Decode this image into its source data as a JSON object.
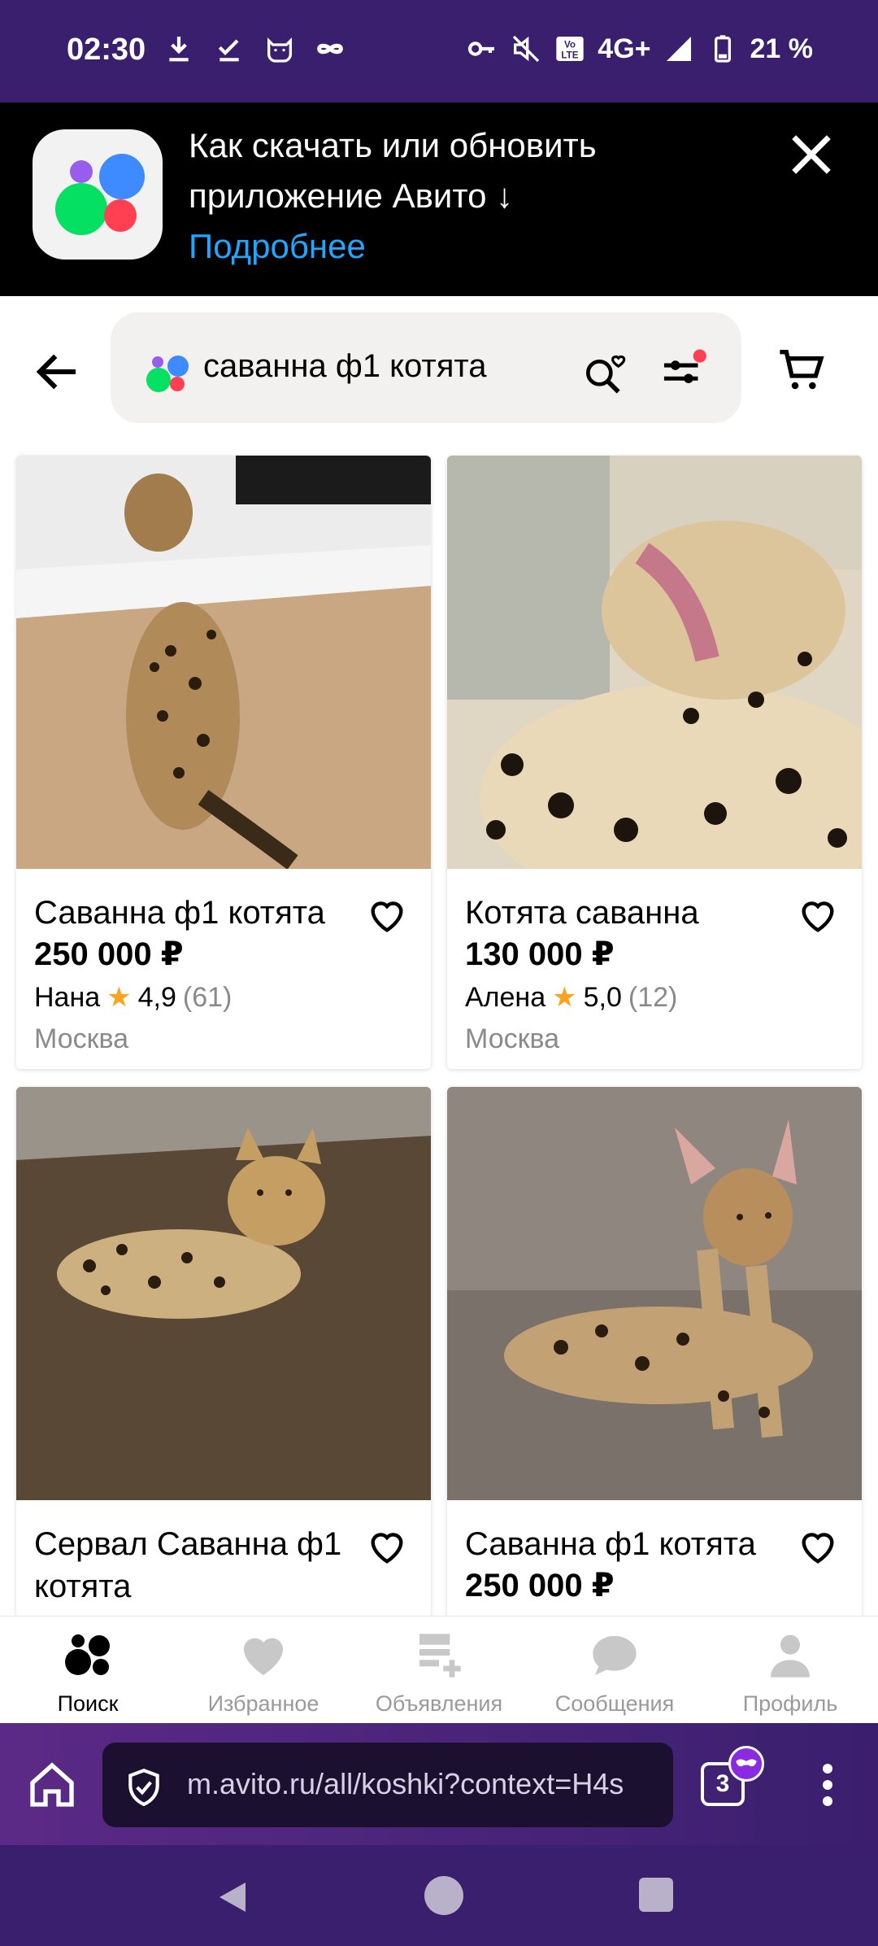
{
  "status_bar": {
    "time": "02:30",
    "network": "4G+",
    "battery": "21 %",
    "left_icons": [
      "download-icon",
      "check-download-icon",
      "cat-icon",
      "vpn-infinity-icon"
    ],
    "right_icons": [
      "key-icon",
      "mute-icon",
      "volte-icon",
      "signal-icon",
      "battery-icon"
    ]
  },
  "banner": {
    "title": "Как скачать или обновить приложение Авито ↓",
    "link": "Подробнее"
  },
  "search": {
    "query": "саванна ф1 котята"
  },
  "listings": [
    {
      "title": "Саванна ф1 котята",
      "price": "250 000 ₽",
      "seller": "Нана",
      "rating": "4,9",
      "reviews": "(61)",
      "city": "Москва"
    },
    {
      "title": "Котята саванна",
      "price": "130 000 ₽",
      "seller": "Алена",
      "rating": "5,0",
      "reviews": "(12)",
      "city": "Москва"
    },
    {
      "title": "Сервал Саванна ф1 котята"
    },
    {
      "title": "Саванна ф1 котята",
      "price": "250 000 ₽"
    }
  ],
  "bottom_nav": [
    {
      "label": "Поиск",
      "icon": "search-dots-icon",
      "active": true
    },
    {
      "label": "Избранное",
      "icon": "heart-icon"
    },
    {
      "label": "Объявления",
      "icon": "listings-add-icon"
    },
    {
      "label": "Сообщения",
      "icon": "chat-bubble-icon"
    },
    {
      "label": "Профиль",
      "icon": "profile-icon"
    }
  ],
  "browser": {
    "url": "m.avito.ru/all/koshki?context=H4s",
    "tab_count": "3"
  },
  "colors": {
    "system_bar": "#3a1f6e",
    "link_blue": "#1ea7ff",
    "star": "#f7a51f"
  }
}
